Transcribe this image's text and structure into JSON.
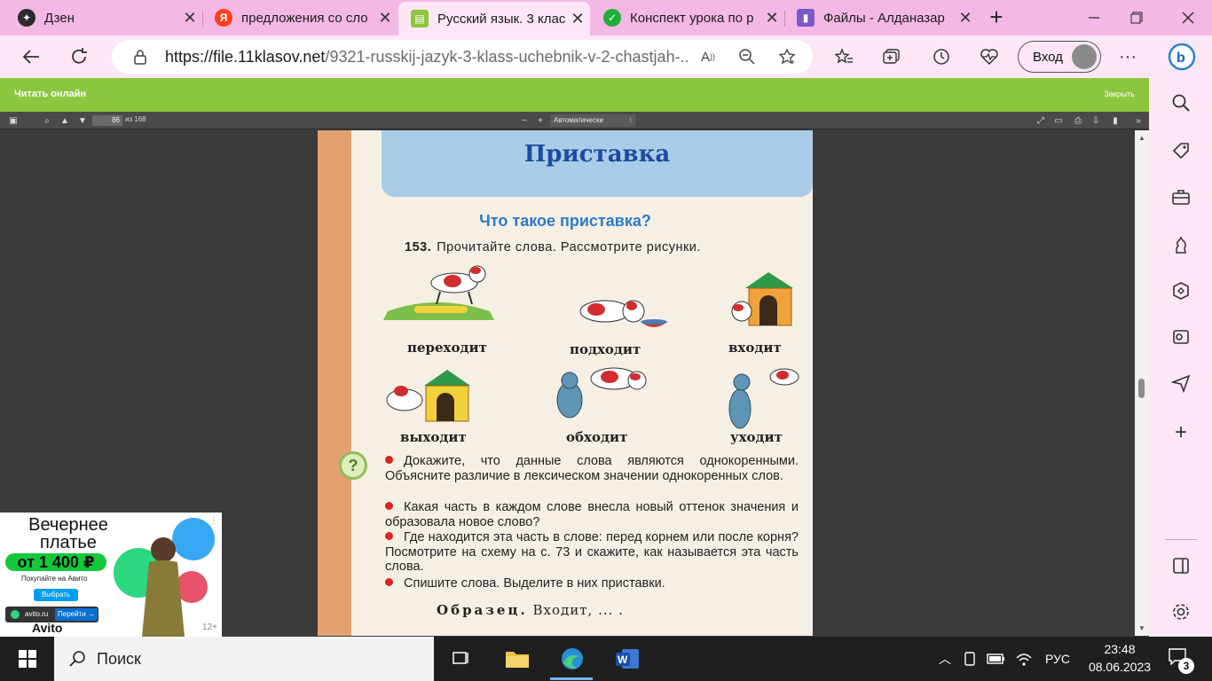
{
  "tabs": [
    {
      "title": "Дзен",
      "favicon": "zen-icon",
      "color": "#2b2b2b"
    },
    {
      "title": "предложения со сло",
      "favicon": "yandex-icon",
      "color": "#fc3f1d"
    },
    {
      "title": "Русский язык. 3 клас",
      "favicon": "book-icon",
      "color": "#8cc63e"
    },
    {
      "title": "Конспект урока по р",
      "favicon": "checkmark-icon",
      "color": "#1fae3c"
    },
    {
      "title": "Файлы - Алданазар",
      "favicon": "folder-icon",
      "color": "#7a59c9"
    }
  ],
  "address": {
    "url_host": "https://file.11klasov.net",
    "url_rest": "/9321-russkij-jazyk-3-klass-uchebnik-v-2-chastjah-..."
  },
  "login_label": "Вход",
  "green_bar": {
    "title": "Читать онлайн",
    "close": "Закрыть"
  },
  "pdf": {
    "page": "86",
    "of": "из 168",
    "zoom": "Автоматически"
  },
  "page": {
    "title": "Приставка",
    "subtitle": "Что такое приставка?",
    "exercise_num": "153.",
    "exercise_text": "Прочитайте слова. Рассмотрите рисунки.",
    "words": [
      "переходит",
      "подходит",
      "входит",
      "выходит",
      "обходит",
      "уходит"
    ],
    "questions": [
      "Докажите, что данные слова являются однокоренными. Объясните различие в лексическом значении однокоренных слов.",
      "Какая часть в каждом слове внесла новый оттенок значения и образовала новое слово?",
      "Где находится эта часть в слове: перед корнем или после корня? Посмотрите на схему на с. 73 и скажите, как называется эта часть слова.",
      "Спишите слова. Выделите в них приставки."
    ],
    "sample_label": "Образец.",
    "sample_text": "Входит, ... ."
  },
  "ad": {
    "headline": "Вечернее платье",
    "price": "от 1 400 ₽",
    "sub": "Покупайте на Авито",
    "button": "Выбрать",
    "domain": "avito.ru",
    "go": "Перейти →",
    "logo": "Avito",
    "age": "12+"
  },
  "taskbar": {
    "search": "Поиск",
    "lang": "РУС",
    "time": "23:48",
    "date": "08.06.2023",
    "notifications": "3"
  }
}
